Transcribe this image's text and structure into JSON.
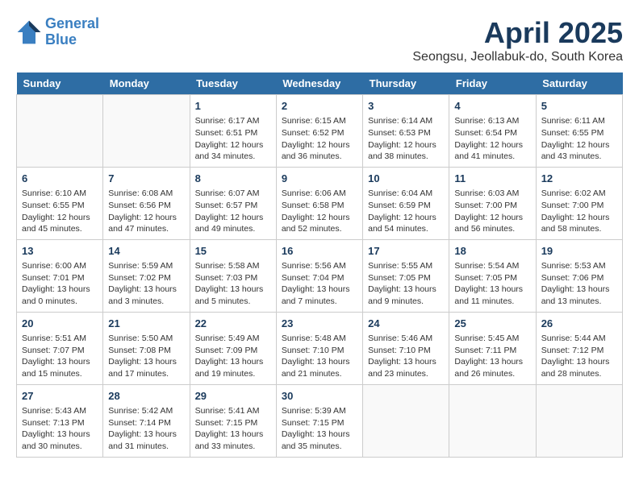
{
  "header": {
    "logo_line1": "General",
    "logo_line2": "Blue",
    "month_title": "April 2025",
    "subtitle": "Seongsu, Jeollabuk-do, South Korea"
  },
  "days_of_week": [
    "Sunday",
    "Monday",
    "Tuesday",
    "Wednesday",
    "Thursday",
    "Friday",
    "Saturday"
  ],
  "weeks": [
    [
      {
        "day": "",
        "info": ""
      },
      {
        "day": "",
        "info": ""
      },
      {
        "day": "1",
        "info": "Sunrise: 6:17 AM\nSunset: 6:51 PM\nDaylight: 12 hours\nand 34 minutes."
      },
      {
        "day": "2",
        "info": "Sunrise: 6:15 AM\nSunset: 6:52 PM\nDaylight: 12 hours\nand 36 minutes."
      },
      {
        "day": "3",
        "info": "Sunrise: 6:14 AM\nSunset: 6:53 PM\nDaylight: 12 hours\nand 38 minutes."
      },
      {
        "day": "4",
        "info": "Sunrise: 6:13 AM\nSunset: 6:54 PM\nDaylight: 12 hours\nand 41 minutes."
      },
      {
        "day": "5",
        "info": "Sunrise: 6:11 AM\nSunset: 6:55 PM\nDaylight: 12 hours\nand 43 minutes."
      }
    ],
    [
      {
        "day": "6",
        "info": "Sunrise: 6:10 AM\nSunset: 6:55 PM\nDaylight: 12 hours\nand 45 minutes."
      },
      {
        "day": "7",
        "info": "Sunrise: 6:08 AM\nSunset: 6:56 PM\nDaylight: 12 hours\nand 47 minutes."
      },
      {
        "day": "8",
        "info": "Sunrise: 6:07 AM\nSunset: 6:57 PM\nDaylight: 12 hours\nand 49 minutes."
      },
      {
        "day": "9",
        "info": "Sunrise: 6:06 AM\nSunset: 6:58 PM\nDaylight: 12 hours\nand 52 minutes."
      },
      {
        "day": "10",
        "info": "Sunrise: 6:04 AM\nSunset: 6:59 PM\nDaylight: 12 hours\nand 54 minutes."
      },
      {
        "day": "11",
        "info": "Sunrise: 6:03 AM\nSunset: 7:00 PM\nDaylight: 12 hours\nand 56 minutes."
      },
      {
        "day": "12",
        "info": "Sunrise: 6:02 AM\nSunset: 7:00 PM\nDaylight: 12 hours\nand 58 minutes."
      }
    ],
    [
      {
        "day": "13",
        "info": "Sunrise: 6:00 AM\nSunset: 7:01 PM\nDaylight: 13 hours\nand 0 minutes."
      },
      {
        "day": "14",
        "info": "Sunrise: 5:59 AM\nSunset: 7:02 PM\nDaylight: 13 hours\nand 3 minutes."
      },
      {
        "day": "15",
        "info": "Sunrise: 5:58 AM\nSunset: 7:03 PM\nDaylight: 13 hours\nand 5 minutes."
      },
      {
        "day": "16",
        "info": "Sunrise: 5:56 AM\nSunset: 7:04 PM\nDaylight: 13 hours\nand 7 minutes."
      },
      {
        "day": "17",
        "info": "Sunrise: 5:55 AM\nSunset: 7:05 PM\nDaylight: 13 hours\nand 9 minutes."
      },
      {
        "day": "18",
        "info": "Sunrise: 5:54 AM\nSunset: 7:05 PM\nDaylight: 13 hours\nand 11 minutes."
      },
      {
        "day": "19",
        "info": "Sunrise: 5:53 AM\nSunset: 7:06 PM\nDaylight: 13 hours\nand 13 minutes."
      }
    ],
    [
      {
        "day": "20",
        "info": "Sunrise: 5:51 AM\nSunset: 7:07 PM\nDaylight: 13 hours\nand 15 minutes."
      },
      {
        "day": "21",
        "info": "Sunrise: 5:50 AM\nSunset: 7:08 PM\nDaylight: 13 hours\nand 17 minutes."
      },
      {
        "day": "22",
        "info": "Sunrise: 5:49 AM\nSunset: 7:09 PM\nDaylight: 13 hours\nand 19 minutes."
      },
      {
        "day": "23",
        "info": "Sunrise: 5:48 AM\nSunset: 7:10 PM\nDaylight: 13 hours\nand 21 minutes."
      },
      {
        "day": "24",
        "info": "Sunrise: 5:46 AM\nSunset: 7:10 PM\nDaylight: 13 hours\nand 23 minutes."
      },
      {
        "day": "25",
        "info": "Sunrise: 5:45 AM\nSunset: 7:11 PM\nDaylight: 13 hours\nand 26 minutes."
      },
      {
        "day": "26",
        "info": "Sunrise: 5:44 AM\nSunset: 7:12 PM\nDaylight: 13 hours\nand 28 minutes."
      }
    ],
    [
      {
        "day": "27",
        "info": "Sunrise: 5:43 AM\nSunset: 7:13 PM\nDaylight: 13 hours\nand 30 minutes."
      },
      {
        "day": "28",
        "info": "Sunrise: 5:42 AM\nSunset: 7:14 PM\nDaylight: 13 hours\nand 31 minutes."
      },
      {
        "day": "29",
        "info": "Sunrise: 5:41 AM\nSunset: 7:15 PM\nDaylight: 13 hours\nand 33 minutes."
      },
      {
        "day": "30",
        "info": "Sunrise: 5:39 AM\nSunset: 7:15 PM\nDaylight: 13 hours\nand 35 minutes."
      },
      {
        "day": "",
        "info": ""
      },
      {
        "day": "",
        "info": ""
      },
      {
        "day": "",
        "info": ""
      }
    ]
  ]
}
